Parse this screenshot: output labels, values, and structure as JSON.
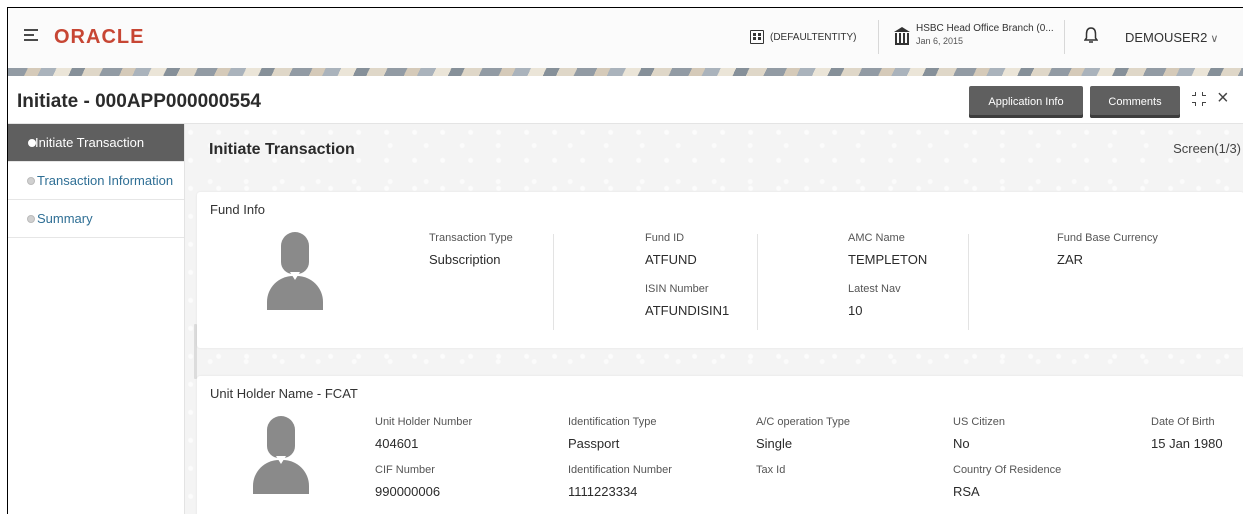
{
  "topbar": {
    "logo": "ORACLE",
    "entity": "(DEFAULTENTITY)",
    "branch_name": "HSBC Head Office Branch (0...",
    "branch_date": "Jan 6, 2015",
    "user": "DEMOUSER2",
    "user_chevron": "∨",
    "icons": {
      "menu": "hamburger-icon",
      "entity": "building-icon",
      "branch": "bank-icon",
      "notifications": "bell-icon"
    }
  },
  "header": {
    "title": "Initiate - 000APP000000554",
    "application_info_label": "Application Info",
    "comments_label": "Comments",
    "close_glyph": "×"
  },
  "nav": {
    "items": [
      {
        "label": "Initiate Transaction",
        "active": true
      },
      {
        "label": "Transaction Information",
        "active": false
      },
      {
        "label": "Summary",
        "active": false
      }
    ]
  },
  "main": {
    "section_title": "Initiate Transaction",
    "screen_indicator": "Screen(1/3)",
    "fund_info": {
      "title": "Fund Info",
      "transaction_type_label": "Transaction Type",
      "transaction_type_value": "Subscription",
      "fund_id_label": "Fund ID",
      "fund_id_value": "ATFUND",
      "isin_label": "ISIN Number",
      "isin_value": "ATFUNDISIN1",
      "amc_name_label": "AMC Name",
      "amc_name_value": "TEMPLETON",
      "latest_nav_label": "Latest Nav",
      "latest_nav_value": "10",
      "base_currency_label": "Fund Base Currency",
      "base_currency_value": "ZAR"
    },
    "unit_holder": {
      "title": "Unit Holder Name - FCAT",
      "unit_holder_number_label": "Unit Holder Number",
      "unit_holder_number_value": "404601",
      "cif_label": "CIF Number",
      "cif_value": "990000006",
      "id_type_label": "Identification Type",
      "id_type_value": "Passport",
      "id_number_label": "Identification Number",
      "id_number_value": "1111223334",
      "ac_op_type_label": "A/C operation Type",
      "ac_op_type_value": "Single",
      "tax_id_label": "Tax Id",
      "tax_id_value": "",
      "us_citizen_label": "US Citizen",
      "us_citizen_value": "No",
      "country_label": "Country Of Residence",
      "country_value": "RSA",
      "dob_label": "Date Of Birth",
      "dob_value": "15 Jan 1980"
    }
  }
}
